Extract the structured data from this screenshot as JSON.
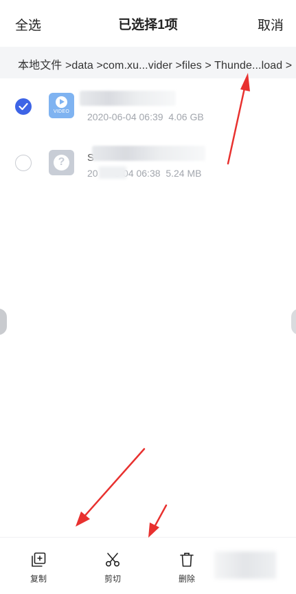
{
  "header": {
    "select_all_label": "全选",
    "title": "已选择1项",
    "cancel_label": "取消"
  },
  "breadcrumb": {
    "path_text": "本地文件 >data >com.xu...vider >files > Thunde...load >"
  },
  "files": [
    {
      "selected": true,
      "icon": "video-file-icon",
      "icon_label": "VIDEO",
      "name": "",
      "date": "2020-06-04 06:39",
      "size": "4.06 GB"
    },
    {
      "selected": false,
      "icon": "unknown-file-icon",
      "icon_label": "?",
      "name_initial": "S",
      "date_prefix": "20",
      "date_suffix": "6-04 06:38",
      "size": "5.24 MB"
    }
  ],
  "toolbar": {
    "copy_label": "复制",
    "cut_label": "剪切",
    "delete_label": "删除"
  },
  "colors": {
    "accent": "#3d64e6",
    "video_icon": "#7fb3f1",
    "unknown_icon": "#c8cdd6",
    "annotation_arrow": "#e8312f"
  }
}
